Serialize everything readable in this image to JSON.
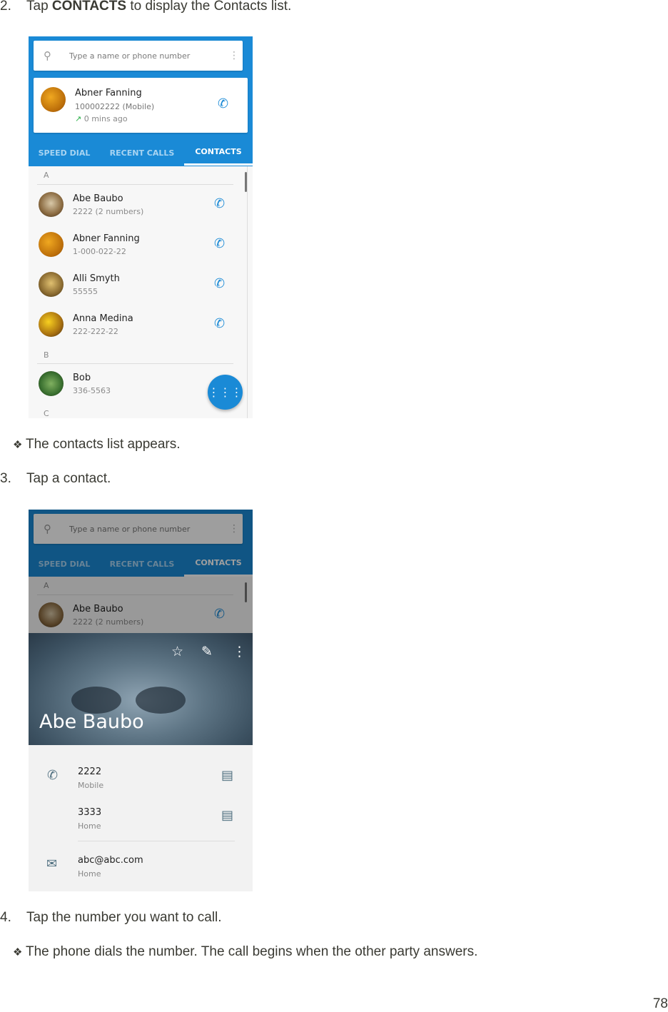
{
  "doc": {
    "step2": {
      "number": "2.",
      "prefix": "Tap ",
      "bold": "CONTACTS",
      "suffix": " to display the Contacts list."
    },
    "bullet1": {
      "glyph": "❖",
      "text": "The contacts list appears."
    },
    "step3": {
      "number": "3.",
      "text": "Tap a contact."
    },
    "step4": {
      "number": "4.",
      "text": "Tap the number you want to call."
    },
    "bullet2": {
      "glyph": "❖",
      "text": "The phone dials the number. The call begins when the other party answers."
    },
    "page_number": "78"
  },
  "screen1": {
    "search": {
      "placeholder": "Type a name or phone number",
      "icon": "search-icon",
      "menu_icon": "more-vert-icon"
    },
    "recent_card": {
      "name": "Abner Fanning",
      "number": "100002222 (Mobile)",
      "time": "0 mins ago",
      "call_direction_icon": "outgoing-arrow-icon"
    },
    "tabs": [
      {
        "label": "SPEED DIAL",
        "active": false
      },
      {
        "label": "RECENT CALLS",
        "active": false
      },
      {
        "label": "CONTACTS",
        "active": true
      }
    ],
    "sections": [
      {
        "letter": "A",
        "contacts": [
          {
            "name": "Abe Baubo",
            "detail": "2222 (2 numbers)"
          },
          {
            "name": "Abner Fanning",
            "detail": "1-000-022-22"
          },
          {
            "name": "Alli Smyth",
            "detail": "55555"
          },
          {
            "name": "Anna Medina",
            "detail": "222-222-22"
          }
        ]
      },
      {
        "letter": "B",
        "contacts": [
          {
            "name": "Bob",
            "detail": "336-5563"
          }
        ]
      },
      {
        "letter": "C",
        "contacts": []
      }
    ],
    "fab_icon": "dialpad-icon"
  },
  "screen2": {
    "search": {
      "placeholder": "Type a name or phone number"
    },
    "tabs": [
      {
        "label": "SPEED DIAL",
        "active": false
      },
      {
        "label": "RECENT CALLS",
        "active": false
      },
      {
        "label": "CONTACTS",
        "active": true
      }
    ],
    "section_letter": "A",
    "contact": {
      "name": "Abe Baubo",
      "detail": "2222 (2 numbers)"
    },
    "card": {
      "name": "Abe Baubo",
      "actions": [
        "star-icon",
        "edit-icon",
        "more-vert-icon"
      ],
      "phones": [
        {
          "number": "2222",
          "type": "Mobile"
        },
        {
          "number": "3333",
          "type": "Home"
        }
      ],
      "email": {
        "address": "abc@abc.com",
        "type": "Home"
      }
    }
  },
  "colors": {
    "accent": "#1a8ad6",
    "text": "#3a3a33"
  }
}
